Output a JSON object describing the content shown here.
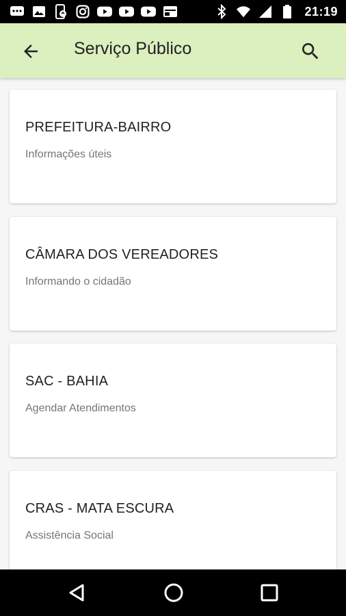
{
  "status_bar": {
    "time": "21:19",
    "icons": [
      "message-icon",
      "gallery-icon",
      "phone-sync-icon",
      "instagram-icon",
      "youtube-icon",
      "youtube-icon",
      "youtube-icon",
      "calendar-icon",
      "bluetooth-icon",
      "wifi-icon",
      "signal-icon",
      "battery-icon"
    ]
  },
  "app_bar": {
    "title": "Serviço Público",
    "back_icon": "arrow-back-icon",
    "search_icon": "search-icon",
    "background": "#dbefbf"
  },
  "items": [
    {
      "title": "PREFEITURA-BAIRRO",
      "subtitle": "Informações úteis"
    },
    {
      "title": "CÂMARA DOS VEREADORES",
      "subtitle": "Informando o cidadão"
    },
    {
      "title": "SAC - BAHIA",
      "subtitle": "Agendar Atendimentos"
    },
    {
      "title": "CRAS - MATA ESCURA",
      "subtitle": "Assistência Social"
    }
  ],
  "nav_bar": {
    "icons": [
      "back-triangle-icon",
      "home-circle-icon",
      "recents-square-icon"
    ]
  }
}
